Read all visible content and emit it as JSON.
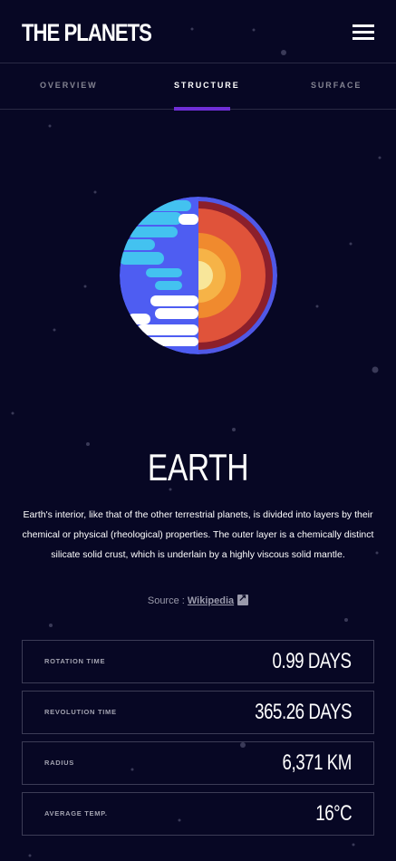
{
  "header": {
    "logo": "THE PLANETS",
    "menu_icon": "hamburger-menu-icon"
  },
  "tabs": [
    {
      "label": "OVERVIEW",
      "active": false
    },
    {
      "label": "STRUCTURE",
      "active": true
    },
    {
      "label": "SURFACE",
      "active": false
    }
  ],
  "planet": {
    "name": "EARTH",
    "image": "earth-internal-structure",
    "description": "Earth's interior, like that of the other terrestrial planets, is divided into layers by their chemical or physical (rheological) properties. The outer layer is a chemically distinct silicate solid crust, which is underlain by a highly viscous solid mantle.",
    "source_prefix": "Source : ",
    "source_link": "Wikipedia",
    "source_icon": "external-link-icon"
  },
  "stats": [
    {
      "label": "ROTATION TIME",
      "value": "0.99 DAYS"
    },
    {
      "label": "REVOLUTION TIME",
      "value": "365.26 DAYS"
    },
    {
      "label": "RADIUS",
      "value": "6,371 KM"
    },
    {
      "label": "AVERAGE TEMP.",
      "value": "16°C"
    }
  ],
  "colors": {
    "background": "#070724",
    "accent": "#6f2ed6",
    "border": "#3c3c56",
    "muted_text": "#838391"
  }
}
